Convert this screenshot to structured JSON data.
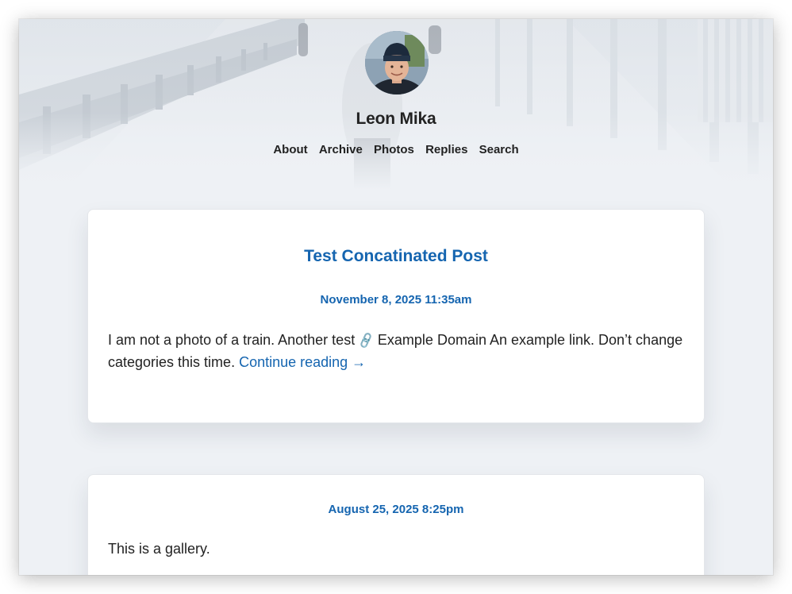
{
  "site": {
    "title": "Leon Mika",
    "nav": [
      "About",
      "Archive",
      "Photos",
      "Replies",
      "Search"
    ]
  },
  "posts": [
    {
      "title": "Test Concatinated Post",
      "date": "November 8, 2025 11:35am",
      "body_before_icon": "I am not a photo of a train. Another test",
      "link_icon": "🔗",
      "body_after_icon": " Example Domain An example link. Don’t change categories this time. ",
      "continue_label": "Continue reading →"
    },
    {
      "date": "August 25, 2025 8:25pm",
      "body": "This is a gallery."
    }
  ],
  "colors": {
    "accent": "#1565b0",
    "text": "#222222",
    "page_background": "#eef1f5",
    "card_background": "#ffffff"
  }
}
